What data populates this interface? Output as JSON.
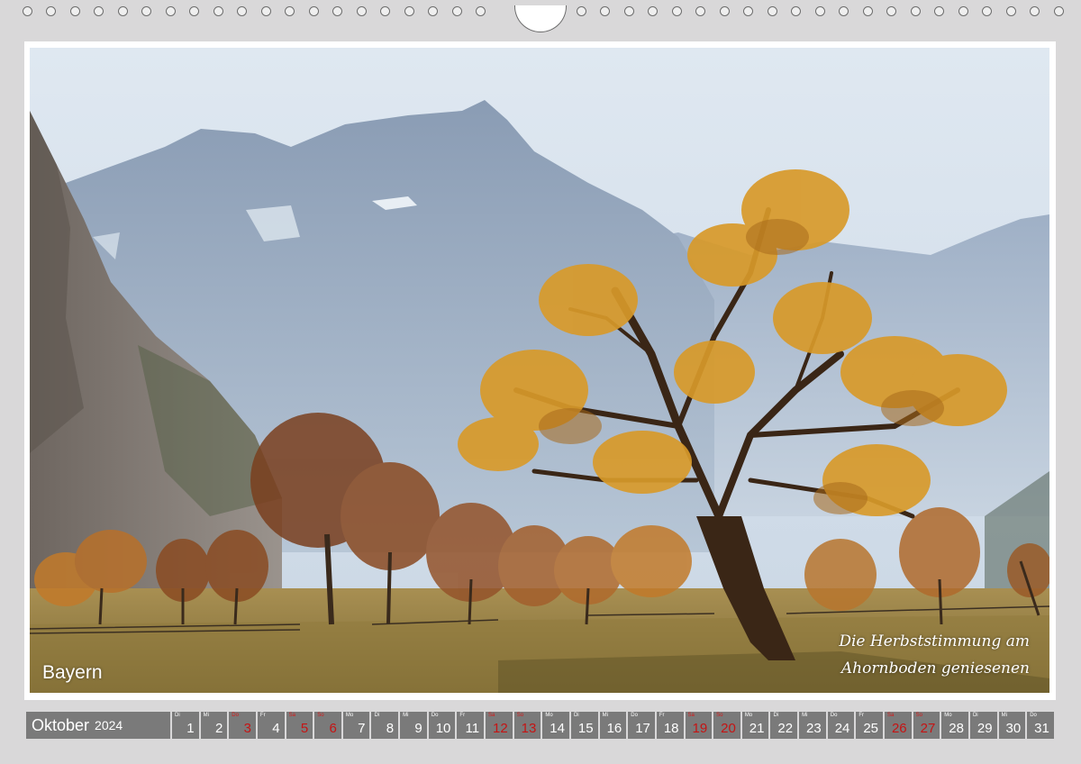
{
  "photo": {
    "region_label": "Bayern",
    "caption_lines": [
      "Die Herbststimmung am",
      "Ahornboden geniesenen"
    ]
  },
  "calendar": {
    "month": "Oktober",
    "year": "2024",
    "weekend_color": "#c51414",
    "cell_color": "#7a7a7a",
    "days": [
      {
        "wd": "Di",
        "d": "1",
        "weekend": false
      },
      {
        "wd": "Mi",
        "d": "2",
        "weekend": false
      },
      {
        "wd": "Do",
        "d": "3",
        "weekend": true
      },
      {
        "wd": "Fr",
        "d": "4",
        "weekend": false
      },
      {
        "wd": "Sa",
        "d": "5",
        "weekend": true
      },
      {
        "wd": "So",
        "d": "6",
        "weekend": true
      },
      {
        "wd": "Mo",
        "d": "7",
        "weekend": false
      },
      {
        "wd": "Di",
        "d": "8",
        "weekend": false
      },
      {
        "wd": "Mi",
        "d": "9",
        "weekend": false
      },
      {
        "wd": "Do",
        "d": "10",
        "weekend": false
      },
      {
        "wd": "Fr",
        "d": "11",
        "weekend": false
      },
      {
        "wd": "Sa",
        "d": "12",
        "weekend": true
      },
      {
        "wd": "So",
        "d": "13",
        "weekend": true
      },
      {
        "wd": "Mo",
        "d": "14",
        "weekend": false
      },
      {
        "wd": "Di",
        "d": "15",
        "weekend": false
      },
      {
        "wd": "Mi",
        "d": "16",
        "weekend": false
      },
      {
        "wd": "Do",
        "d": "17",
        "weekend": false
      },
      {
        "wd": "Fr",
        "d": "18",
        "weekend": false
      },
      {
        "wd": "Sa",
        "d": "19",
        "weekend": true
      },
      {
        "wd": "So",
        "d": "20",
        "weekend": true
      },
      {
        "wd": "Mo",
        "d": "21",
        "weekend": false
      },
      {
        "wd": "Di",
        "d": "22",
        "weekend": false
      },
      {
        "wd": "Mi",
        "d": "23",
        "weekend": false
      },
      {
        "wd": "Do",
        "d": "24",
        "weekend": false
      },
      {
        "wd": "Fr",
        "d": "25",
        "weekend": false
      },
      {
        "wd": "Sa",
        "d": "26",
        "weekend": true
      },
      {
        "wd": "So",
        "d": "27",
        "weekend": true
      },
      {
        "wd": "Mo",
        "d": "28",
        "weekend": false
      },
      {
        "wd": "Di",
        "d": "29",
        "weekend": false
      },
      {
        "wd": "Mi",
        "d": "30",
        "weekend": false
      },
      {
        "wd": "Do",
        "d": "31",
        "weekend": false
      }
    ]
  }
}
